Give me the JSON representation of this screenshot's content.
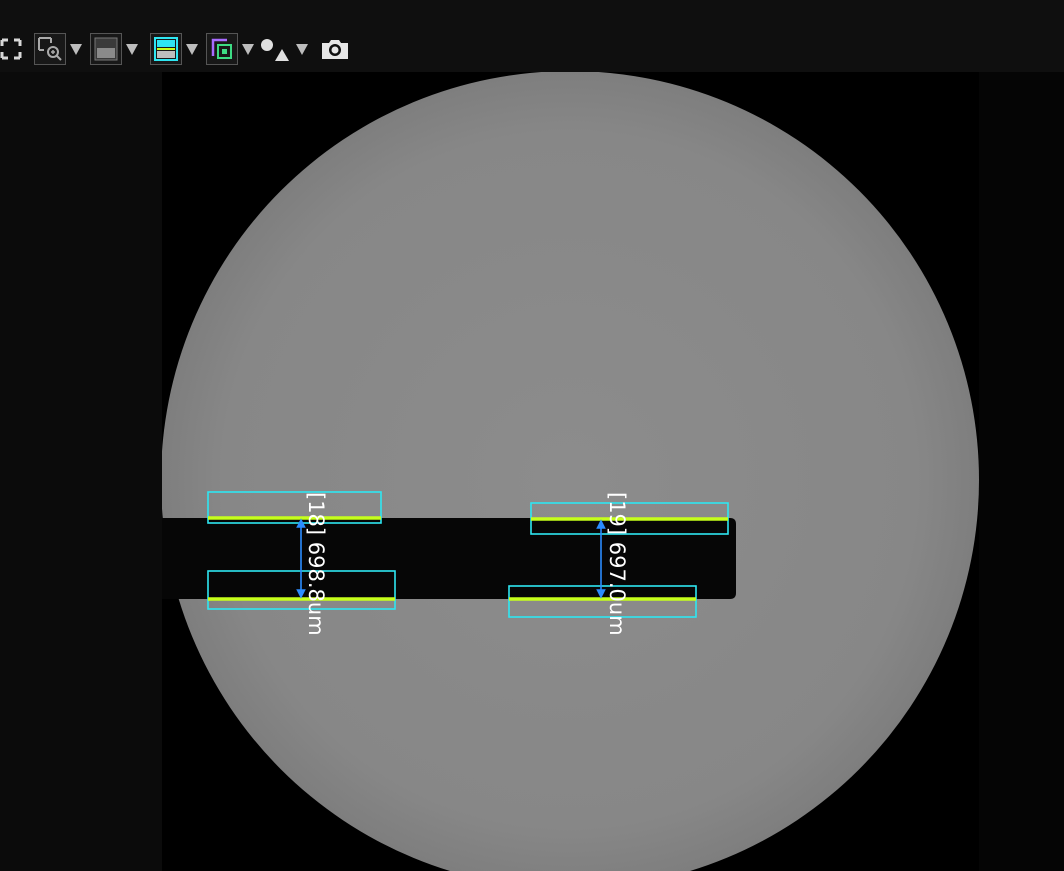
{
  "toolbar": {
    "tools": [
      {
        "name": "fullscreen-icon"
      },
      {
        "name": "zoom-region-icon",
        "has_dropdown": true
      },
      {
        "name": "display-mode-icon",
        "has_dropdown": true
      },
      {
        "name": "edge-line-icon",
        "has_dropdown": true
      },
      {
        "name": "overlay-region-icon",
        "has_dropdown": true
      },
      {
        "name": "shapes-icon",
        "has_dropdown": true
      },
      {
        "name": "camera-icon"
      }
    ]
  },
  "colors": {
    "field_of_view": "#8a8a8a",
    "specimen": "#060606",
    "roi_box": "#2ee6f2",
    "edge_line": "#c6ff1a",
    "dimension_arrow": "#2b8cff",
    "label_text": "#ffffff"
  },
  "measurements": [
    {
      "id": "18",
      "text": "[18] 698.8um"
    },
    {
      "id": "19",
      "text": "[19] 697.0um"
    }
  ]
}
